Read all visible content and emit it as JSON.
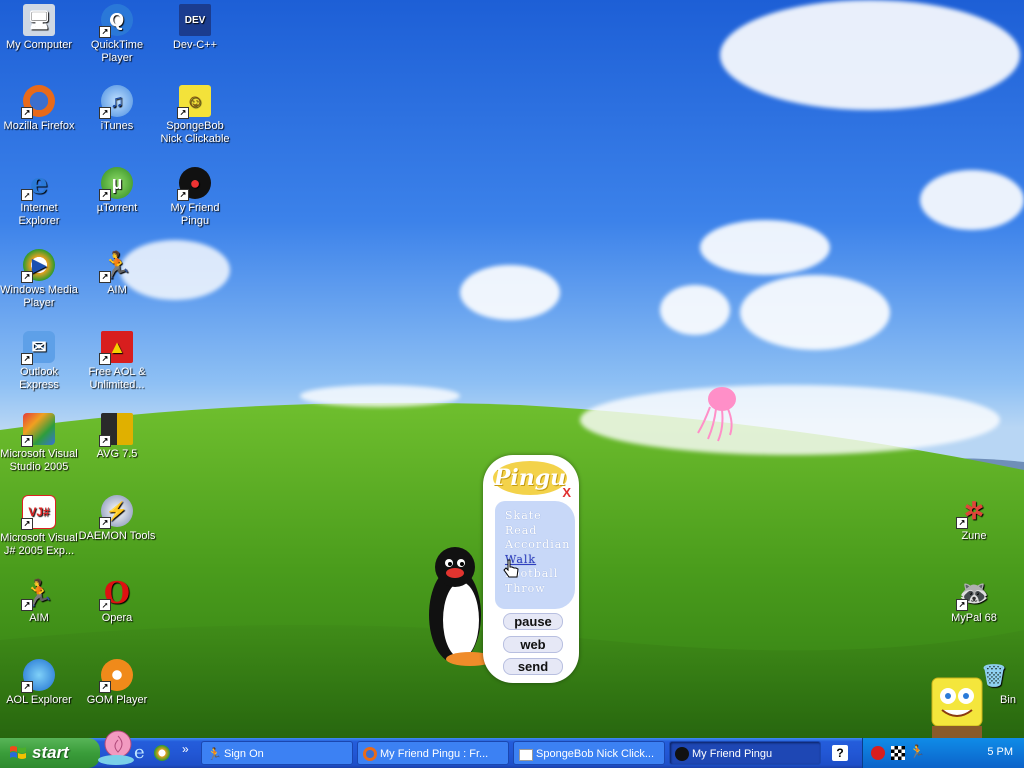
{
  "desktop_icons": [
    {
      "label": "My Computer",
      "icon": "computer-icon"
    },
    {
      "label": "QuickTime Player",
      "icon": "quicktime-icon"
    },
    {
      "label": "Dev-C++",
      "icon": "devcpp-icon",
      "badge": "DEV"
    },
    {
      "label": "Mozilla Firefox",
      "icon": "firefox-icon"
    },
    {
      "label": "iTunes",
      "icon": "itunes-icon"
    },
    {
      "label": "SpongeBob Nick Clickable",
      "icon": "spongebob-icon"
    },
    {
      "label": "Internet Explorer",
      "icon": "ie-icon"
    },
    {
      "label": "µTorrent",
      "icon": "utorrent-icon"
    },
    {
      "label": "My Friend Pingu",
      "icon": "pingu-icon"
    },
    {
      "label": "Windows Media Player",
      "icon": "wmp-icon"
    },
    {
      "label": "AIM",
      "icon": "aim-icon"
    },
    {
      "label": "Outlook Express",
      "icon": "outlook-icon"
    },
    {
      "label": "Free AOL & Unlimited...",
      "icon": "aol-icon"
    },
    {
      "label": "Microsoft Visual Studio 2005",
      "icon": "visual-studio-icon"
    },
    {
      "label": "AVG 7.5",
      "icon": "avg-icon"
    },
    {
      "label": "Microsoft Visual J# 2005 Exp...",
      "icon": "visual-j-icon"
    },
    {
      "label": "DAEMON Tools",
      "icon": "daemon-tools-icon"
    },
    {
      "label": "AIM",
      "icon": "aim-icon"
    },
    {
      "label": "Opera",
      "icon": "opera-icon"
    },
    {
      "label": "AOL Explorer",
      "icon": "aol-explorer-icon"
    },
    {
      "label": "GOM Player",
      "icon": "gom-player-icon"
    },
    {
      "label": "Zune",
      "icon": "zune-icon"
    },
    {
      "label": "MyPal 68",
      "icon": "mypal-icon"
    },
    {
      "label": "Bin",
      "icon": "recycle-bin-icon"
    }
  ],
  "pingu_widget": {
    "logo": "Pingu",
    "close": "X",
    "menu": [
      "Skate",
      "Read",
      "Accordian",
      "Walk",
      "Football",
      "Throw"
    ],
    "active_item": "Walk",
    "buttons": {
      "pause": "pause",
      "web": "web",
      "send": "send"
    }
  },
  "taskbar": {
    "start_label": "start",
    "quicklaunch_more": "»",
    "tasks": [
      {
        "label": "Sign On",
        "icon": "aim-icon"
      },
      {
        "label": "My Friend Pingu : Fr...",
        "icon": "firefox-icon"
      },
      {
        "label": "SpongeBob Nick Click...",
        "icon": "window-icon"
      },
      {
        "label": "My Friend Pingu",
        "icon": "pingu-icon"
      }
    ],
    "help_label": "?",
    "clock": "5 PM"
  },
  "colors": {
    "accent": "#245ddb",
    "start_green": "#3a9d3a",
    "tray": "#0c63c9"
  }
}
